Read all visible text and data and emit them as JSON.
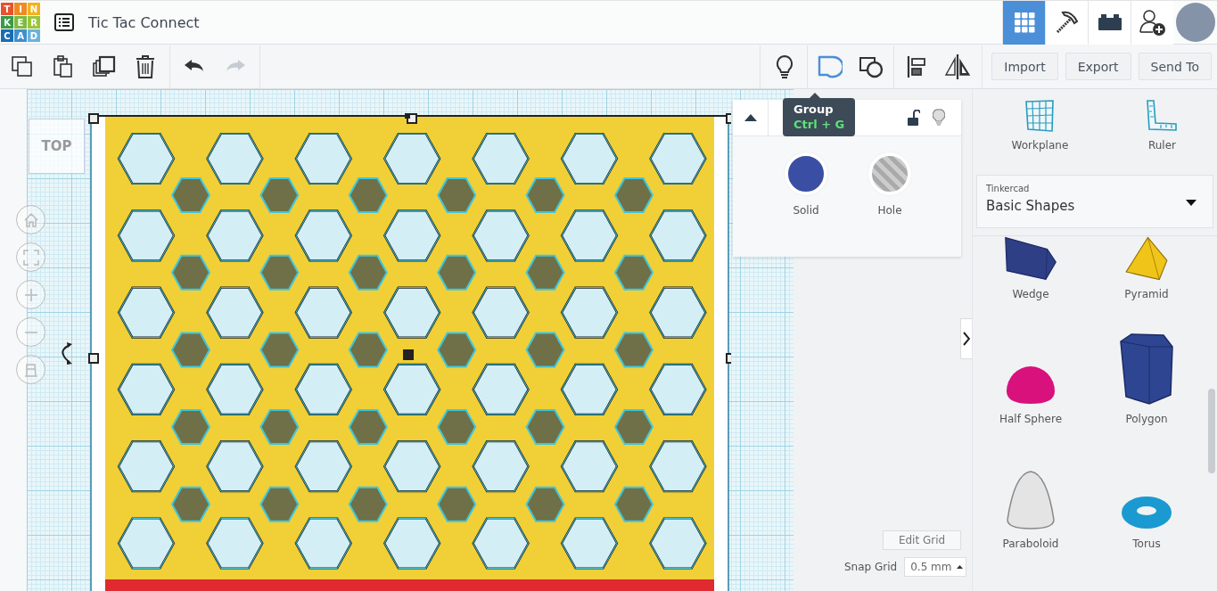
{
  "header": {
    "logo_letters": [
      "T",
      "I",
      "N",
      "K",
      "E",
      "R",
      "C",
      "A",
      "D"
    ],
    "title": "Tic Tac Connect",
    "views": [
      {
        "kind": "grid",
        "selected": true
      },
      {
        "kind": "pickaxe",
        "selected": false
      },
      {
        "kind": "bricks",
        "selected": false
      }
    ]
  },
  "toolbar": {
    "edit_tools": [
      {
        "kind": "copy",
        "disabled": false
      },
      {
        "kind": "paste",
        "disabled": false
      },
      {
        "kind": "duplicate",
        "disabled": false
      },
      {
        "kind": "delete",
        "disabled": false
      },
      {
        "kind": "undo",
        "disabled": false
      },
      {
        "kind": "redo",
        "disabled": true
      }
    ],
    "shape_tools": [
      {
        "kind": "bulb",
        "active": false
      },
      {
        "kind": "group",
        "active": true
      },
      {
        "kind": "ungroup",
        "active": false
      },
      {
        "kind": "align",
        "active": false
      },
      {
        "kind": "mirror",
        "active": false
      }
    ],
    "actions": [
      "Import",
      "Export",
      "Send To"
    ]
  },
  "tooltip": {
    "title": "Group",
    "shortcut": "Ctrl + G"
  },
  "view_cube": {
    "label": "TOP"
  },
  "inspector": {
    "options": [
      {
        "kind": "solid",
        "label": "Solid"
      },
      {
        "kind": "hole",
        "label": "Hole"
      }
    ]
  },
  "grid_controls": {
    "edit_grid": "Edit Grid",
    "snap_label": "Snap Grid",
    "snap_value": "0.5 mm"
  },
  "right_panel": {
    "tools": [
      {
        "kind": "workplane",
        "label": "Workplane"
      },
      {
        "kind": "ruler",
        "label": "Ruler"
      }
    ],
    "library": {
      "label": "Tinkercad",
      "value": "Basic Shapes"
    },
    "shapes": [
      {
        "kind": "wedge",
        "label": "Wedge"
      },
      {
        "kind": "pyramid",
        "label": "Pyramid"
      },
      {
        "kind": "half_sphere",
        "label": "Half Sphere"
      },
      {
        "kind": "polygon",
        "label": "Polygon"
      },
      {
        "kind": "paraboloid",
        "label": "Paraboloid"
      },
      {
        "kind": "torus",
        "label": "Torus"
      }
    ]
  }
}
